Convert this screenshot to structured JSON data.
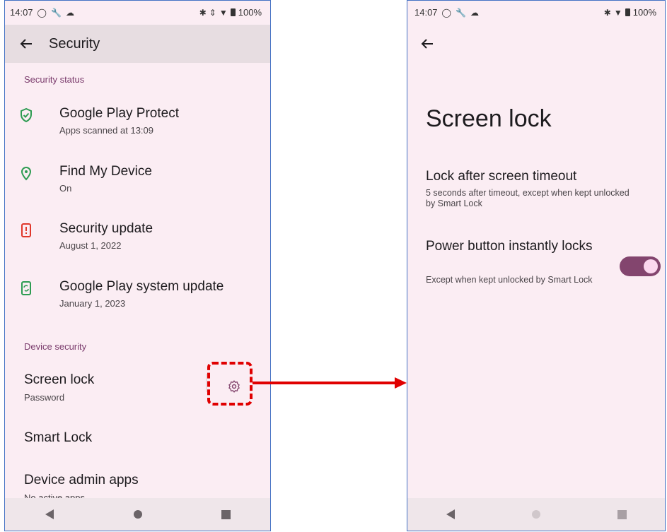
{
  "status_bar": {
    "time": "14:07",
    "battery": "100%"
  },
  "left_screen": {
    "title": "Security",
    "sections": [
      {
        "header": "Security status",
        "items": [
          {
            "title": "Google Play Protect",
            "subtitle": "Apps scanned at 13:09",
            "icon": "shield-check-icon",
            "icon_color": "#2e9c52"
          },
          {
            "title": "Find My Device",
            "subtitle": "On",
            "icon": "location-pin-icon",
            "icon_color": "#2e9c52"
          },
          {
            "title": "Security update",
            "subtitle": "August 1, 2022",
            "icon": "phone-alert-icon",
            "icon_color": "#e0382b"
          },
          {
            "title": "Google Play system update",
            "subtitle": "January 1, 2023",
            "icon": "phone-refresh-icon",
            "icon_color": "#2e9c52"
          }
        ]
      },
      {
        "header": "Device security",
        "items": [
          {
            "title": "Screen lock",
            "subtitle": "Password",
            "trailing_icon": "gear-icon"
          },
          {
            "title": "Smart Lock"
          },
          {
            "title": "Device admin apps",
            "subtitle": "No active apps"
          }
        ]
      }
    ]
  },
  "right_screen": {
    "title": "Screen lock",
    "items": [
      {
        "title": "Lock after screen timeout",
        "subtitle": "5 seconds after timeout, except when kept unlocked by Smart Lock"
      },
      {
        "title": "Power button instantly locks",
        "subtitle": "Except when kept unlocked by Smart Lock",
        "toggle_on": true
      }
    ]
  },
  "colors": {
    "accent": "#83456e",
    "annotation": "#e00000",
    "background": "#fbedf3"
  }
}
